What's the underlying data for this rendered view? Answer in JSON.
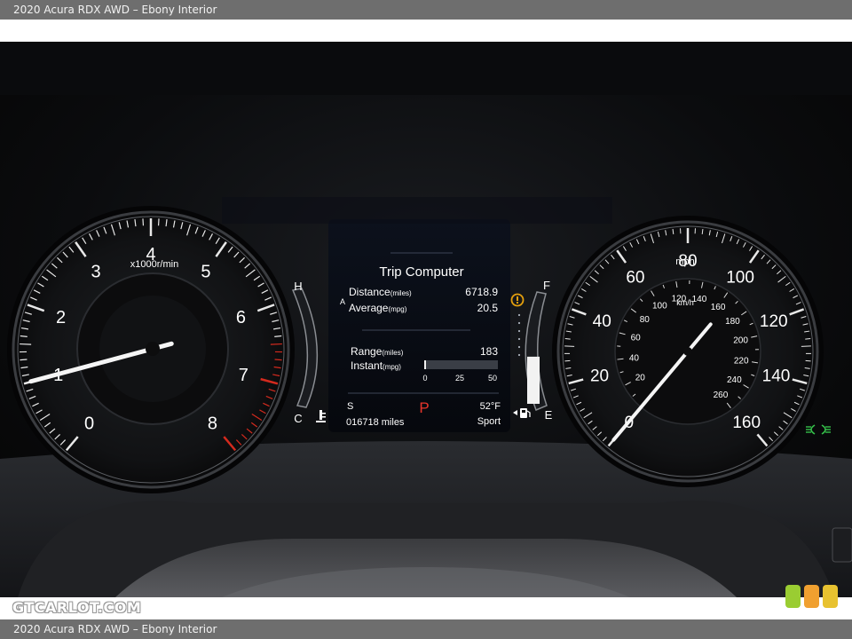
{
  "caption": {
    "top": "2020 Acura RDX AWD – Ebony Interior",
    "bottom": "2020 Acura RDX AWD – Ebony Interior"
  },
  "tachometer": {
    "numbers": [
      "0",
      "1",
      "2",
      "3",
      "4",
      "5",
      "6",
      "7",
      "8"
    ],
    "unit": "x1000r/min",
    "needle_value": 1.0
  },
  "temp_gauge": {
    "high": "H",
    "low": "C"
  },
  "fuel_gauge": {
    "full": "F",
    "empty": "E",
    "level": 0.45
  },
  "trip_computer": {
    "title": "Trip Computer",
    "trip_letter": "A",
    "distance_label": "Distance",
    "distance_unit": "(miles)",
    "distance_value": "6718.9",
    "average_label": "Average",
    "average_unit": "(mpg)",
    "average_value": "20.5",
    "range_label": "Range",
    "range_unit": "(miles)",
    "range_value": "183",
    "instant_label": "Instant",
    "instant_unit": "(mpg)",
    "instant_scale": [
      "0",
      "25",
      "50"
    ],
    "instant_level": 0.02
  },
  "status": {
    "mode_letter": "S",
    "gear": "P",
    "temperature": "52°F",
    "odometer": "016718 miles",
    "drive_mode": "Sport"
  },
  "speedometer": {
    "mph_numbers": [
      "0",
      "20",
      "40",
      "60",
      "80",
      "100",
      "120",
      "140",
      "160"
    ],
    "mph_unit": "mph",
    "kmh_numbers": [
      "20",
      "40",
      "60",
      "80",
      "100",
      "120",
      "140",
      "160",
      "180",
      "200",
      "220",
      "240",
      "260"
    ],
    "kmh_unit": "km/h",
    "needle_value": 0
  },
  "watermark": "GTCARLOT.COM",
  "colors": {
    "redline": "#d42a1e",
    "gear_p": "#e8352b",
    "warning_amber": "#e5a00d",
    "lamp_green": "#35c04a"
  }
}
